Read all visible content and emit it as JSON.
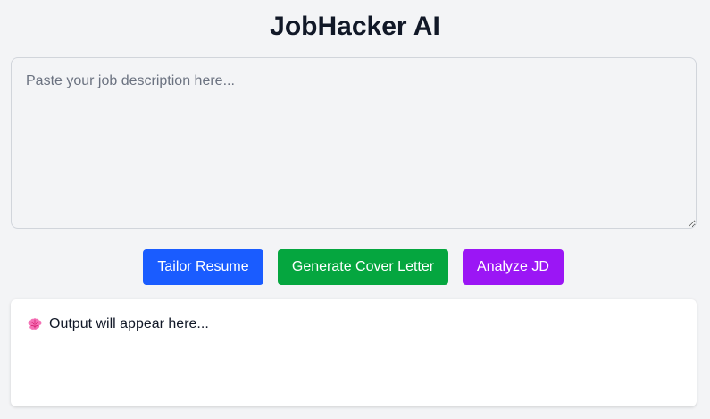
{
  "app": {
    "title": "JobHacker AI"
  },
  "job_description": {
    "value": "",
    "placeholder": "Paste your job description here..."
  },
  "actions": {
    "tailor_resume_label": "Tailor Resume",
    "generate_cover_letter_label": "Generate Cover Letter",
    "analyze_jd_label": "Analyze JD"
  },
  "output": {
    "icon": "brain-icon",
    "text": "Output will appear here..."
  },
  "colors": {
    "background": "#f3f4f6",
    "tailor_button": "#1a5cff",
    "cover_button": "#05a63f",
    "analyze_button": "#9b16f5",
    "brain_icon": "#f472b6"
  }
}
